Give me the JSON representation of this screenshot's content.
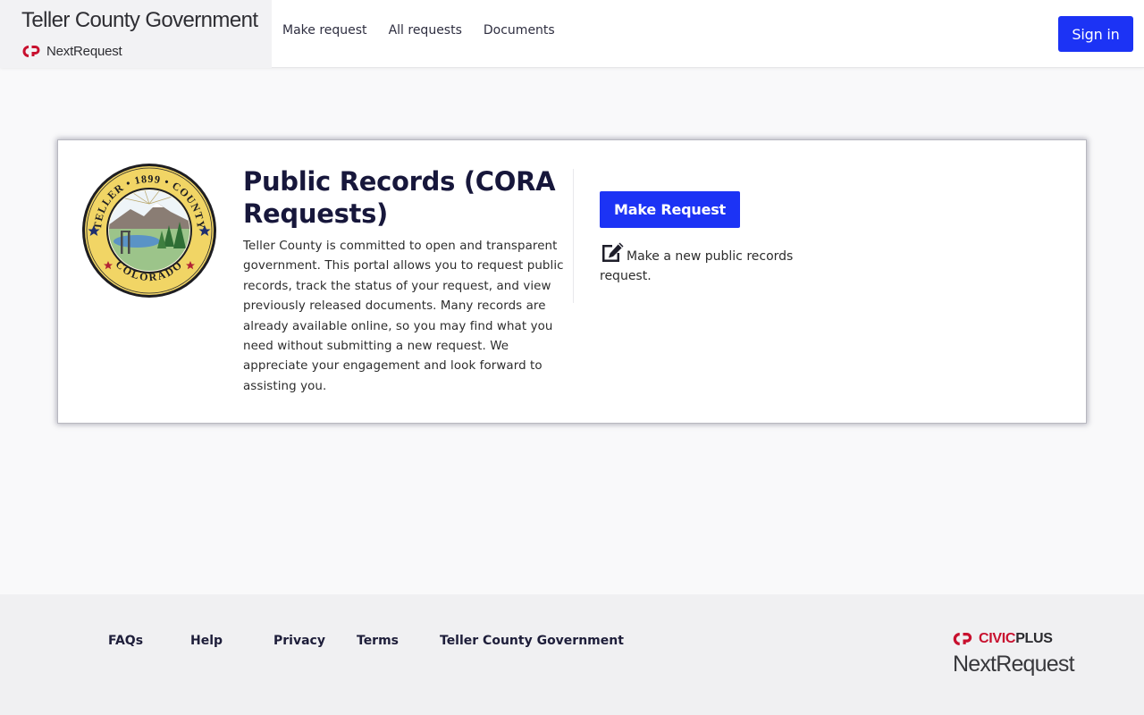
{
  "header": {
    "brand_title": "Teller County Government",
    "brand_sub": "NextRequest",
    "nav": [
      {
        "label": "Make request"
      },
      {
        "label": "All requests"
      },
      {
        "label": "Documents"
      }
    ],
    "signin_label": "Sign in"
  },
  "card": {
    "seal": {
      "top_text": "TELLER",
      "top_text_right": "COUNTY",
      "year": "1899",
      "bottom_text": "COLORADO"
    },
    "title": "Public Records (CORA Requests)",
    "description": "Teller County is committed to open and transparent government. This portal allows you to request public records, track the status of your request, and view previously released documents. Many records are already available online, so you may find what you need without submitting a new request. We appreciate your engagement and look forward to assisting you.",
    "make_request_label": "Make Request",
    "make_request_note": "Make a new public records request."
  },
  "footer": {
    "links": [
      {
        "label": "FAQs"
      },
      {
        "label": "Help"
      },
      {
        "label": "Privacy"
      },
      {
        "label": "Terms"
      },
      {
        "label": "Teller County Government"
      }
    ],
    "civic_red": "CIVIC",
    "civic_dark": "PLUS",
    "nextrequest": "NextRequest"
  },
  "colors": {
    "accent": "#1c33f5",
    "civic_red": "#c8102e",
    "title": "#17173b"
  },
  "icons": {
    "brand_logo": "civicplus-logo-icon",
    "seal": "county-seal-icon",
    "edit": "edit-icon"
  }
}
